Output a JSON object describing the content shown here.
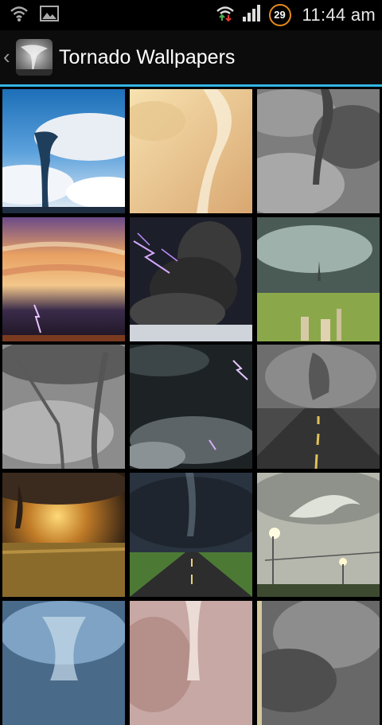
{
  "status_bar": {
    "time": "11:44 am",
    "battery_level": "29",
    "icons": [
      "wifi-icon",
      "image-notification-icon",
      "sync-icon",
      "signal-icon",
      "battery-icon"
    ]
  },
  "action_bar": {
    "title": "Tornado Wallpapers",
    "up_icon": "chevron-left-icon",
    "app_icon": "tornado-app-icon",
    "accent_color": "#33b5e5"
  },
  "wallpapers": [
    {
      "name": "wallpaper-tornado-blue-sky"
    },
    {
      "name": "wallpaper-tornado-sepia"
    },
    {
      "name": "wallpaper-tornado-gray-funnel"
    },
    {
      "name": "wallpaper-sunset-supercell-lightning"
    },
    {
      "name": "wallpaper-lightning-smoke-cloud"
    },
    {
      "name": "wallpaper-supercell-fence-field"
    },
    {
      "name": "wallpaper-twin-tornadoes"
    },
    {
      "name": "wallpaper-dark-clouds-lightning"
    },
    {
      "name": "wallpaper-tornado-road-fog"
    },
    {
      "name": "wallpaper-tornado-golden-field"
    },
    {
      "name": "wallpaper-tornado-green-road"
    },
    {
      "name": "wallpaper-tornado-stadium-lights"
    },
    {
      "name": "wallpaper-blue-vortex"
    },
    {
      "name": "wallpaper-pink-tornado"
    },
    {
      "name": "wallpaper-gray-storm-clouds"
    }
  ]
}
